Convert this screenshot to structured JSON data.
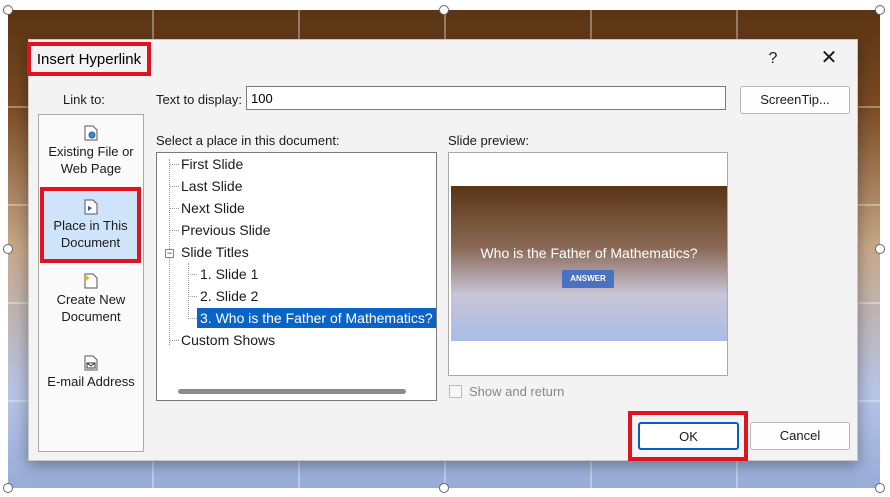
{
  "dialog": {
    "title": "Insert Hyperlink",
    "help_label": "?",
    "close_label": "✕"
  },
  "link_to": {
    "label": "Link to:",
    "items": [
      {
        "label": "Existing File or Web Page",
        "icon": "file-globe-icon"
      },
      {
        "label": "Place in This Document",
        "icon": "document-place-icon",
        "selected": true
      },
      {
        "label": "Create New Document",
        "icon": "new-document-icon"
      },
      {
        "label": "E-mail Address",
        "icon": "email-icon"
      }
    ]
  },
  "text_to_display": {
    "label": "Text to display:",
    "value": "100"
  },
  "screentip_label": "ScreenTip...",
  "place": {
    "label": "Select a place in this document:",
    "tree": [
      "First Slide",
      "Last Slide",
      "Next Slide",
      "Previous Slide",
      "Slide Titles",
      "1. Slide 1",
      "2. Slide 2",
      "3. Who is the Father of Mathematics?",
      "Custom Shows"
    ],
    "selected": "3. Who is the Father of Mathematics?"
  },
  "preview": {
    "label": "Slide preview:",
    "slide_title": "Who is the Father of Mathematics?",
    "slide_button": "ANSWER"
  },
  "show_and_return": {
    "label": "Show and return",
    "checked": false
  },
  "buttons": {
    "ok": "OK",
    "cancel": "Cancel"
  },
  "colors": {
    "highlight_red": "#e0141e",
    "selection_blue": "#0a64c8"
  }
}
